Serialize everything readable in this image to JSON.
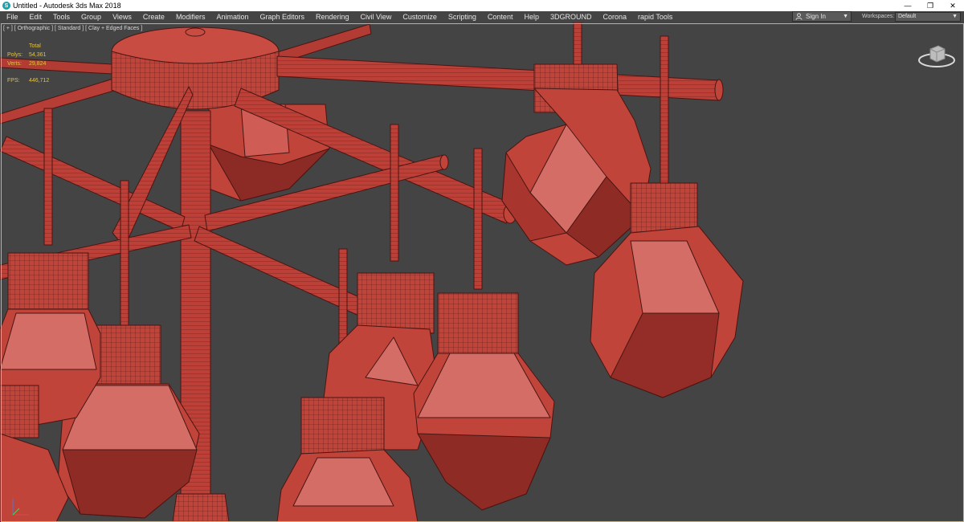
{
  "window": {
    "title": "Untitled - Autodesk 3ds Max 2018",
    "controls": {
      "minimize": "—",
      "restore": "❐",
      "close": "✕"
    }
  },
  "menu": {
    "items": [
      "File",
      "Edit",
      "Tools",
      "Group",
      "Views",
      "Create",
      "Modifiers",
      "Animation",
      "Graph Editors",
      "Rendering",
      "Civil View",
      "Customize",
      "Scripting",
      "Content",
      "Help",
      "3DGROUND",
      "Corona",
      "rapid Tools"
    ]
  },
  "signin": {
    "label": "Sign In"
  },
  "workspaces": {
    "label": "Workspaces:",
    "value": "Default"
  },
  "viewport": {
    "label": "[ + ] [ Orthographic ] [ Standard ] [ Clay + Edged Faces ]",
    "stats": {
      "total_label": "Total",
      "polys_label": "Polys:",
      "polys_value": "54,361",
      "verts_label": "Verts:",
      "verts_value": "29,824",
      "fps_label": "FPS:",
      "fps_value": "446,712"
    }
  },
  "colors": {
    "background": "#444444",
    "model_fill": "#c0443a",
    "model_light": "#d76d69",
    "model_dark": "#7d2622",
    "viewport_border": "#e2b33a",
    "stats_text": "#e0c24a"
  },
  "icons": {
    "app": "3ds-max-icon",
    "signin": "user-icon",
    "viewcube": "viewcube-icon",
    "axis": "axis-tripod-icon"
  }
}
